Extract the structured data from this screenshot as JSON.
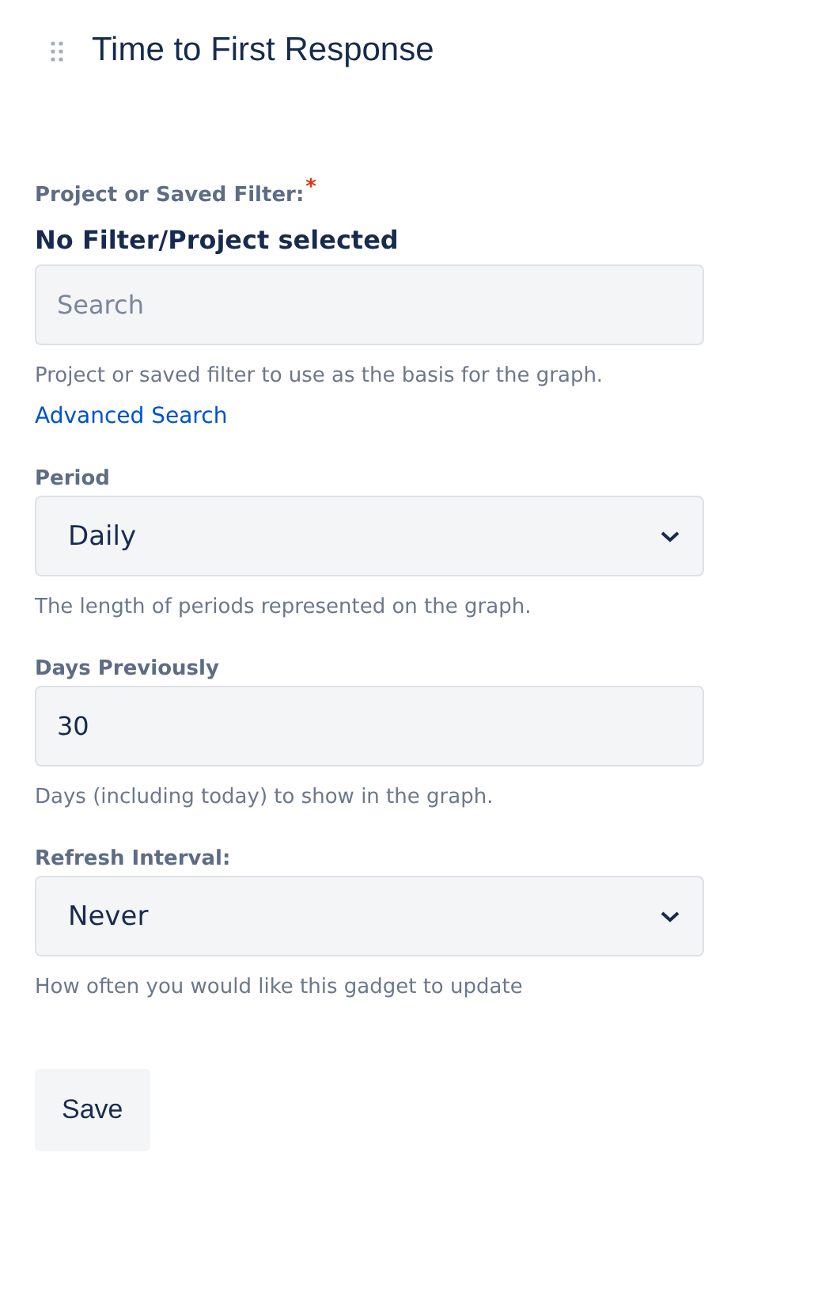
{
  "title": "Time to First Response",
  "fields": [
    {
      "kind": "picker",
      "label": "Project or Saved Filter:",
      "required_mark": "*",
      "selection": "No Filter/Project selected",
      "placeholder": "Search",
      "help": "Project or saved filter to use as the basis for the graph.",
      "link": "Advanced Search"
    },
    {
      "kind": "select",
      "label": "Period",
      "value": "Daily",
      "help": "The length of periods represented on the graph."
    },
    {
      "kind": "text",
      "label": "Days Previously",
      "value": "30",
      "help": "Days (including today) to show in the graph."
    },
    {
      "kind": "select",
      "label": "Refresh Interval:",
      "value": "Never",
      "help": "How often you would like this gadget to update"
    }
  ],
  "save_button": "Save"
}
